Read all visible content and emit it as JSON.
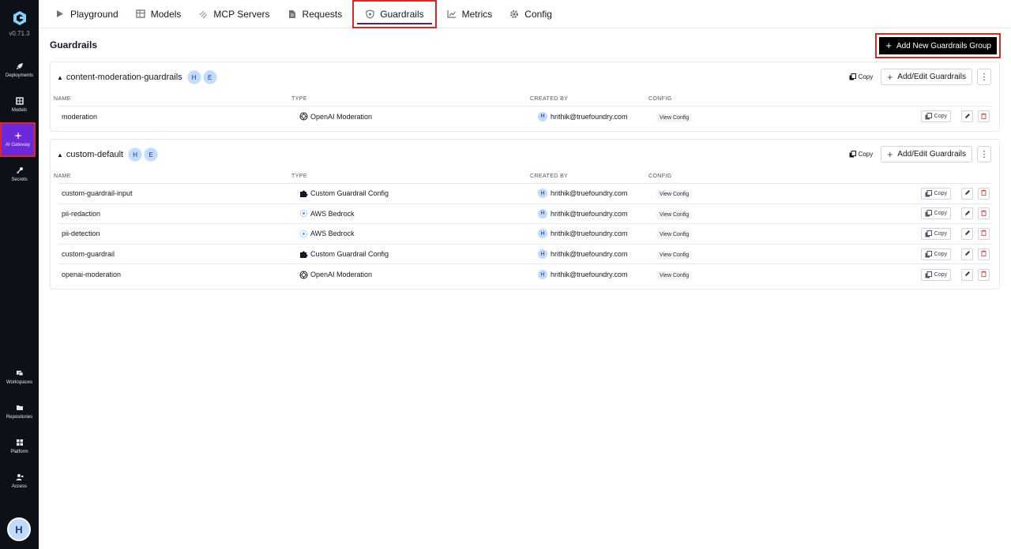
{
  "sidebar": {
    "version": "v0.71.3",
    "items_top": [
      {
        "label": "Deployments",
        "icon": "rocket-icon"
      },
      {
        "label": "Models",
        "icon": "grid-icon"
      },
      {
        "label": "AI Gateway",
        "icon": "gateway-icon"
      },
      {
        "label": "Secrets",
        "icon": "key-icon"
      }
    ],
    "items_bottom": [
      {
        "label": "Workspaces",
        "icon": "workspaces-icon"
      },
      {
        "label": "Repositories",
        "icon": "folder-icon"
      },
      {
        "label": "Platform",
        "icon": "platform-icon"
      },
      {
        "label": "Access",
        "icon": "access-icon"
      }
    ],
    "avatar": "H"
  },
  "tabs": [
    {
      "label": "Playground",
      "icon": "play-icon"
    },
    {
      "label": "Models",
      "icon": "table-icon"
    },
    {
      "label": "MCP Servers",
      "icon": "mcp-icon"
    },
    {
      "label": "Requests",
      "icon": "document-icon"
    },
    {
      "label": "Guardrails",
      "icon": "shield-icon"
    },
    {
      "label": "Metrics",
      "icon": "chart-icon"
    },
    {
      "label": "Config",
      "icon": "gear-icon"
    }
  ],
  "page": {
    "title": "Guardrails",
    "add_group_label": "Add New Guardrails Group"
  },
  "labels": {
    "copy": "Copy",
    "add_edit": "Add/Edit Guardrails",
    "view_config": "View Config",
    "col_name": "NAME",
    "col_type": "TYPE",
    "col_created_by": "CREATED BY",
    "col_config": "CONFIG"
  },
  "groups": [
    {
      "name": "content-moderation-guardrails",
      "badges": [
        "H",
        "E"
      ],
      "rows": [
        {
          "name": "moderation",
          "type": "OpenAI Moderation",
          "type_icon": "openai-icon",
          "created_by": "hrithik@truefoundry.com",
          "avatar": "H"
        }
      ]
    },
    {
      "name": "custom-default",
      "badges": [
        "H",
        "E"
      ],
      "rows": [
        {
          "name": "custom-guardrail-input",
          "type": "Custom Guardrail Config",
          "type_icon": "puzzle-icon",
          "created_by": "hrithik@truefoundry.com",
          "avatar": "H"
        },
        {
          "name": "pii-redaction",
          "type": "AWS Bedrock",
          "type_icon": "bedrock-icon",
          "created_by": "hrithik@truefoundry.com",
          "avatar": "H"
        },
        {
          "name": "pii-detection",
          "type": "AWS Bedrock",
          "type_icon": "bedrock-icon",
          "created_by": "hrithik@truefoundry.com",
          "avatar": "H"
        },
        {
          "name": "custom-guardrail",
          "type": "Custom Guardrail Config",
          "type_icon": "puzzle-icon",
          "created_by": "hrithik@truefoundry.com",
          "avatar": "H"
        },
        {
          "name": "openai-moderation",
          "type": "OpenAI Moderation",
          "type_icon": "openai-icon",
          "created_by": "hrithik@truefoundry.com",
          "avatar": "H"
        }
      ]
    }
  ],
  "colors": {
    "sidebar_bg": "#0d1117",
    "active_sidebar": "#6d28d9",
    "highlight": "#dc2626",
    "badge": "#bfdbfe"
  }
}
